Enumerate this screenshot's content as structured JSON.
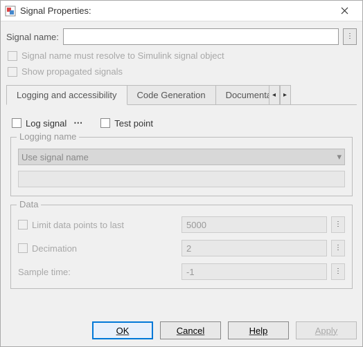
{
  "title": "Signal Properties:",
  "signal_name": {
    "label": "Signal name:",
    "value": ""
  },
  "checks": {
    "resolve": "Signal name must resolve to Simulink signal object",
    "propagated": "Show propagated signals"
  },
  "tabs": {
    "logging": "Logging and accessibility",
    "codegen": "Code Generation",
    "document": "Documentation"
  },
  "logging_tab": {
    "log_signal": "Log signal",
    "test_point": "Test point",
    "logging_name": {
      "legend": "Logging name",
      "select": "Use signal name"
    },
    "data": {
      "legend": "Data",
      "limit": {
        "label": "Limit data points to last",
        "value": "5000"
      },
      "decimation": {
        "label": "Decimation",
        "value": "2"
      },
      "sample_time": {
        "label": "Sample time:",
        "value": "-1"
      }
    }
  },
  "buttons": {
    "ok": "OK",
    "cancel": "Cancel",
    "help": "Help",
    "apply": "Apply"
  }
}
